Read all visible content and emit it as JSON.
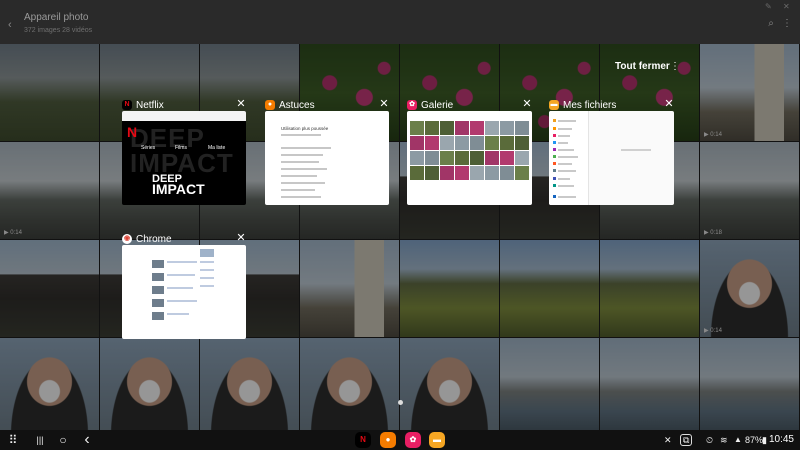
{
  "app_header": {
    "title": "Appareil photo",
    "subtitle": "372 images 28 vidéos",
    "back_glyph": "‹",
    "search_glyph": "⌕",
    "more_glyph": "⋮"
  },
  "grid": {
    "tiles": [
      {
        "kind": "t-park",
        "badge": ""
      },
      {
        "kind": "t-park",
        "badge": ""
      },
      {
        "kind": "t-park",
        "badge": ""
      },
      {
        "kind": "t-tulip",
        "badge": ""
      },
      {
        "kind": "t-tulip",
        "badge": ""
      },
      {
        "kind": "t-tulip",
        "badge": ""
      },
      {
        "kind": "t-tulip",
        "badge": ""
      },
      {
        "kind": "t-building",
        "badge": "▶ 0:14"
      },
      {
        "kind": "t-street",
        "badge": "▶ 0:14"
      },
      {
        "kind": "t-street",
        "badge": ""
      },
      {
        "kind": "t-street",
        "badge": ""
      },
      {
        "kind": "t-street",
        "badge": ""
      },
      {
        "kind": "t-tower",
        "badge": ""
      },
      {
        "kind": "t-tower",
        "badge": ""
      },
      {
        "kind": "t-street",
        "badge": ""
      },
      {
        "kind": "t-street",
        "badge": "▶ 0:18"
      },
      {
        "kind": "t-tower",
        "badge": ""
      },
      {
        "kind": "t-tower",
        "badge": ""
      },
      {
        "kind": "t-tower",
        "badge": ""
      },
      {
        "kind": "t-building",
        "badge": ""
      },
      {
        "kind": "t-field",
        "badge": ""
      },
      {
        "kind": "t-field",
        "badge": ""
      },
      {
        "kind": "t-field",
        "badge": ""
      },
      {
        "kind": "t-face",
        "badge": "▶ 0:14"
      },
      {
        "kind": "t-face",
        "badge": ""
      },
      {
        "kind": "t-face",
        "badge": ""
      },
      {
        "kind": "t-face",
        "badge": ""
      },
      {
        "kind": "t-face",
        "badge": ""
      },
      {
        "kind": "t-face",
        "badge": ""
      },
      {
        "kind": "t-river",
        "badge": ""
      },
      {
        "kind": "t-river",
        "badge": ""
      },
      {
        "kind": "t-river",
        "badge": ""
      }
    ]
  },
  "recents": {
    "close_all_label": "Tout fermer",
    "more_glyph": "⋮",
    "close_glyph": "✕",
    "cards": {
      "netflix": {
        "name": "Netflix",
        "icon_letter": "N",
        "color": "#e50914"
      },
      "astuces": {
        "name": "Astuces",
        "icon_letter": "💡",
        "color": "#f57c00"
      },
      "galerie": {
        "name": "Galerie",
        "icon_letter": "✿",
        "color": "#e91e63"
      },
      "fichiers": {
        "name": "Mes fichiers",
        "icon_letter": "▬",
        "color": "#f5a623"
      },
      "chrome": {
        "name": "Chrome",
        "icon_letter": "◉",
        "color": "#4285f4"
      }
    },
    "netflix_preview": {
      "logo": "N",
      "menu": [
        "Séries",
        "Films",
        "Ma liste"
      ],
      "title_line1": "DEEP",
      "title_line2": "IMPACT",
      "ghost": "DEEP IMPACT"
    },
    "astuces_preview": {
      "heading": "Utilisation plus poussée"
    }
  },
  "taskbar": {
    "apps_glyph": "⠿",
    "recents_glyph": "|||",
    "home_glyph": "○",
    "back_glyph": "‹",
    "dock": [
      {
        "name": "netflix",
        "glyph": "N",
        "bg": "#000000",
        "fg": "#e50914"
      },
      {
        "name": "astuces",
        "glyph": "💡",
        "bg": "#f57c00",
        "fg": "#ffffff"
      },
      {
        "name": "galerie",
        "glyph": "✿",
        "bg": "#e91e63",
        "fg": "#ffffff"
      },
      {
        "name": "mes-fichiers",
        "glyph": "▬",
        "bg": "#f5a623",
        "fg": "#ffffff"
      }
    ],
    "status": {
      "mute_glyph": "🔇",
      "screenshot_glyph": "⧉",
      "alarm_glyph": "⏲",
      "wifi_glyph": "≋",
      "signal_glyph": "▲",
      "battery": "87%",
      "battery_glyph": "▮",
      "time": "10:45"
    }
  }
}
